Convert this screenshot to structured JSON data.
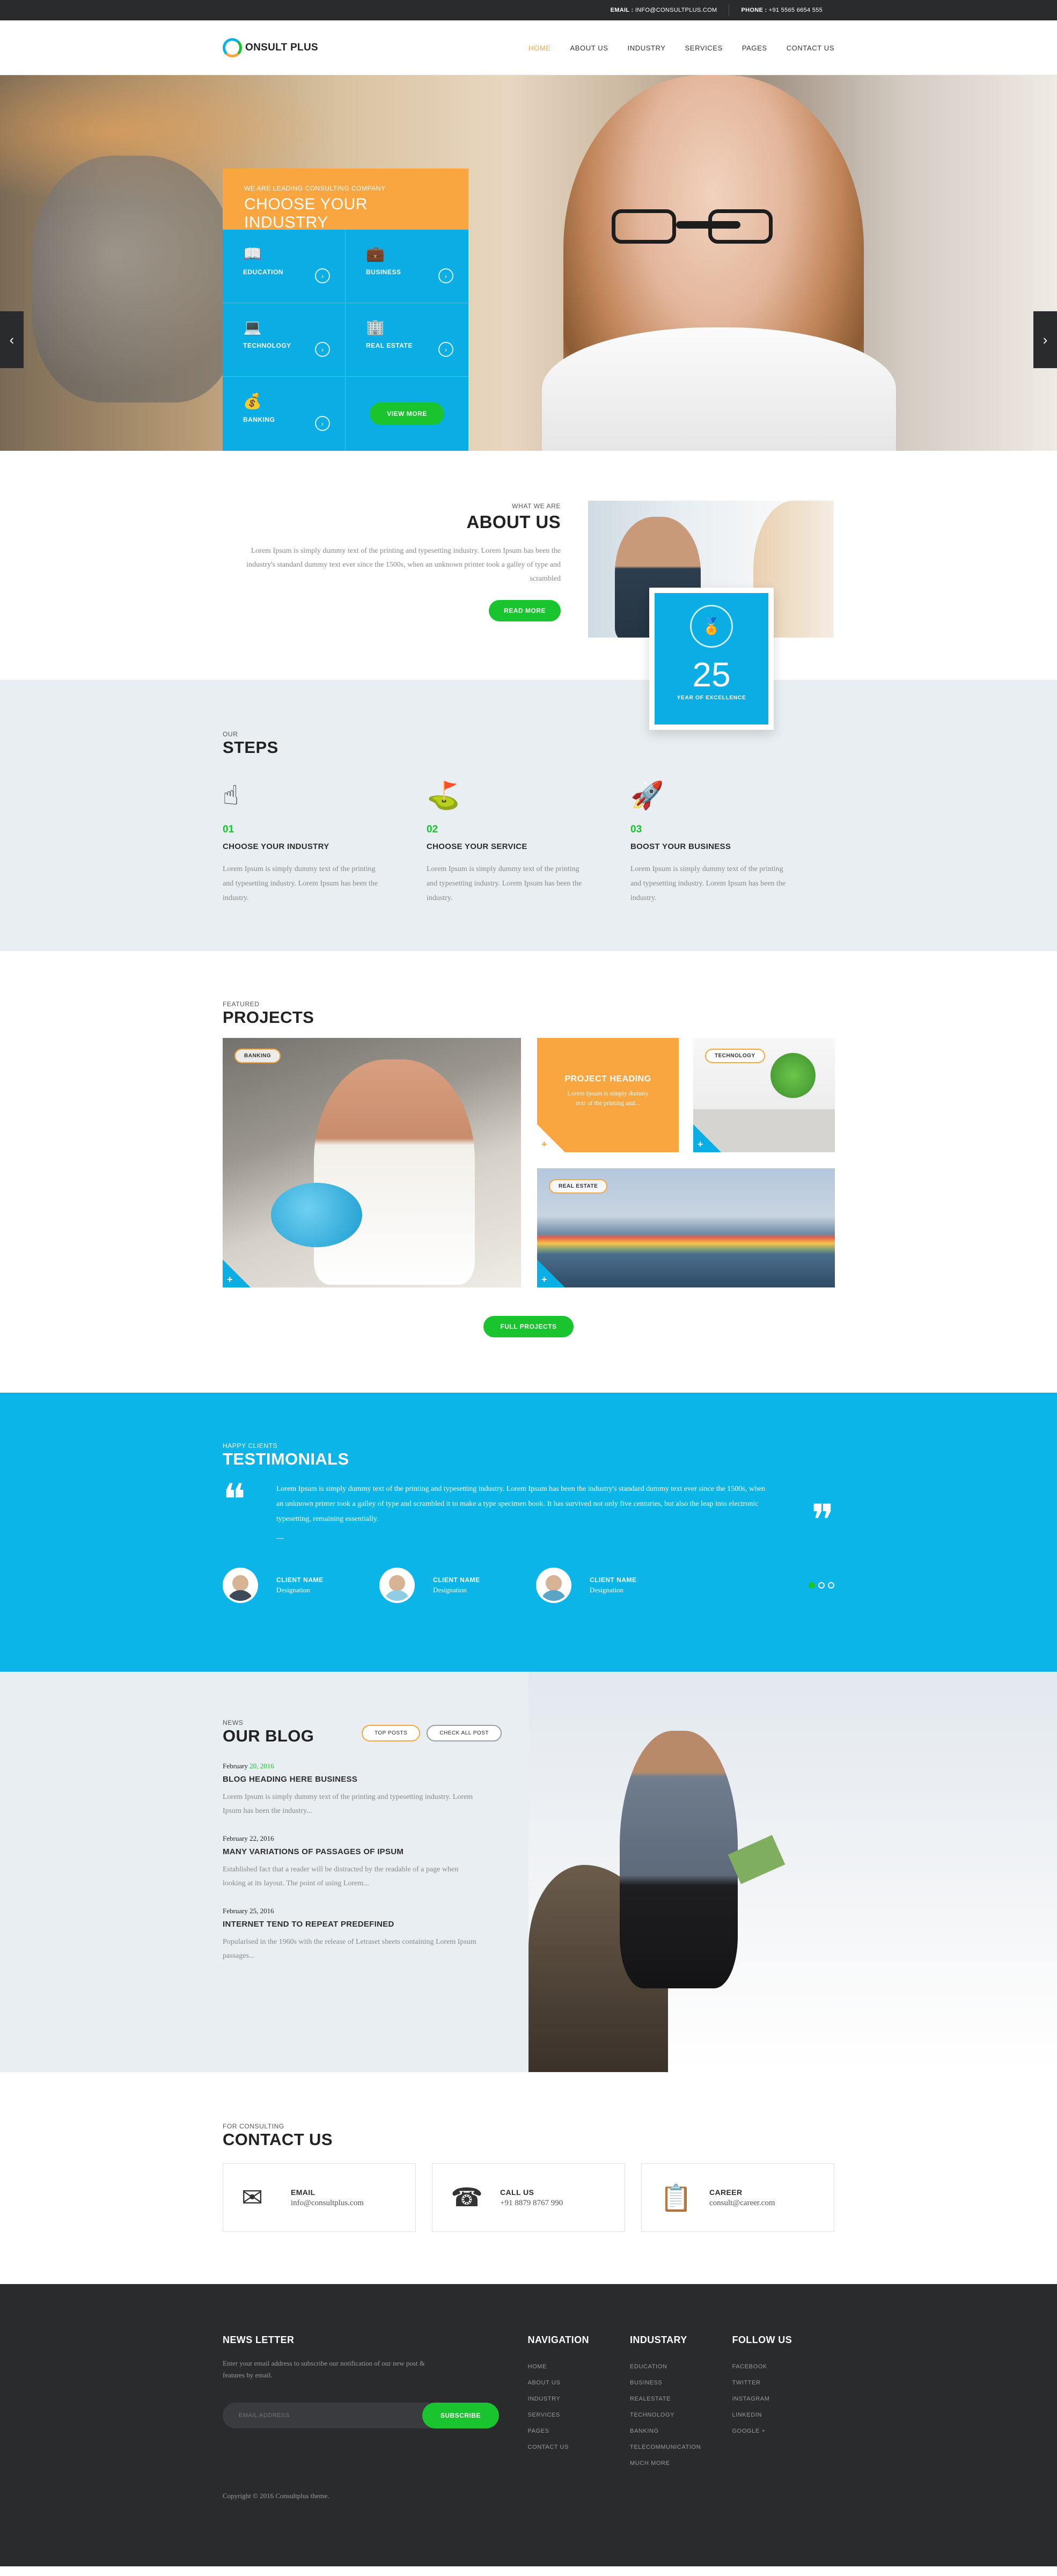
{
  "topbar": {
    "email_label": "EMAIL :",
    "email_value": "INFO@CONSULTPLUS.COM",
    "phone_label": "PHONE :",
    "phone_value": "+91 5565 6654 555"
  },
  "header": {
    "logo_text": "ONSULT PLUS",
    "nav": [
      "HOME",
      "ABOUT US",
      "INDUSTRY",
      "SERVICES",
      "PAGES",
      "CONTACT US"
    ]
  },
  "hero": {
    "eyebrow": "WE ARE LEADING CONSULTING COMPANY",
    "title": "CHOOSE YOUR INDUSTRY",
    "industries": [
      {
        "label": "EDUCATION",
        "icon": "book-icon"
      },
      {
        "label": "BUSINESS",
        "icon": "briefcase-icon"
      },
      {
        "label": "TECHNOLOGY",
        "icon": "laptop-icon"
      },
      {
        "label": "REAL ESTATE",
        "icon": "building-icon"
      },
      {
        "label": "BANKING",
        "icon": "money-bag-icon"
      }
    ],
    "view_more": "VIEW MORE"
  },
  "about": {
    "eyebrow": "WHAT WE ARE",
    "title": "ABOUT US",
    "text": "Lorem Ipsum is simply dummy text of the printing and typesetting industry. Lorem Ipsum has been the industry's standard dummy text ever since the 1500s, when an unknown printer took a galley of type and scrambled",
    "button": "READ MORE",
    "years_number": "25",
    "years_caption": "YEAR OF EXCELLENCE"
  },
  "steps": {
    "eyebrow": "OUR",
    "title": "STEPS",
    "items": [
      {
        "num": "01",
        "title": "CHOOSE YOUR INDUSTRY",
        "text": "Lorem Ipsum is simply dummy text of the printing and typesetting industry. Lorem Ipsum has been the industry."
      },
      {
        "num": "02",
        "title": "CHOOSE YOUR SERVICE",
        "text": "Lorem Ipsum is simply dummy text of the printing and typesetting industry. Lorem Ipsum has been the industry."
      },
      {
        "num": "03",
        "title": "BOOST YOUR BUSINESS",
        "text": "Lorem Ipsum is simply dummy text of the printing and typesetting industry. Lorem Ipsum has been the industry."
      }
    ]
  },
  "projects": {
    "eyebrow": "FEATURED",
    "title": "PROJECTS",
    "tag_banking": "BANKING",
    "tag_technology": "TECHNOLOGY",
    "tag_real_estate": "REAL ESTATE",
    "heading": "PROJECT HEADING",
    "heading_text": "Lorem Ipsum is simply dummy text of the printing and...",
    "button": "FULL PROJECTS"
  },
  "testimonials": {
    "eyebrow": "HAPPY CLIENTS",
    "title": "TESTIMONIALS",
    "quote": "Lorem Ipsum is simply dummy text of the printing and typesetting industry. Lorem Ipsum has been the industry's standard dummy text ever since the 1500s, when an unknown printer took a galley of type and scrambled it to make a type specimen book. It has survived not only five centuries, but also the leap into electronic typesetting, remaining essentially.",
    "dash": "—",
    "clients": [
      {
        "name": "CLIENT NAME",
        "designation": "Designation"
      },
      {
        "name": "CLIENT NAME",
        "designation": "Designation"
      },
      {
        "name": "CLIENT NAME",
        "designation": "Designation"
      }
    ]
  },
  "blog": {
    "eyebrow": "NEWS",
    "title": "OUR BLOG",
    "tab_top": "TOP POSTS",
    "tab_all": "CHECK ALL POST",
    "posts": [
      {
        "date_prefix": "February ",
        "date_day": "20, 2016",
        "title": "BLOG HEADING HERE BUSINESS",
        "text": "Lorem Ipsum is simply dummy text of the printing and typesetting industry. Lorem Ipsum has been the industry..."
      },
      {
        "date_prefix": "February 22, 2016",
        "date_day": "",
        "title": "MANY VARIATIONS OF PASSAGES OF IPSUM",
        "text": "Established fact that a reader will be distracted by the readable of a page when looking at its layout. The point of using Lorem..."
      },
      {
        "date_prefix": "February 25, 2016",
        "date_day": "",
        "title": "INTERNET TEND TO REPEAT PREDEFINED",
        "text": "Popularised in the 1960s with the release of Letraset sheets containing Lorem Ipsum passages..."
      }
    ]
  },
  "contact": {
    "eyebrow": "FOR CONSULTING",
    "title": "CONTACT US",
    "cards": [
      {
        "title": "EMAIL",
        "value": "info@consultplus.com",
        "icon": "envelope-icon"
      },
      {
        "title": "CALL US",
        "value": "+91 8879 8767 990",
        "icon": "phone-icon"
      },
      {
        "title": "CAREER",
        "value": "consult@career.com",
        "icon": "presentation-icon"
      }
    ]
  },
  "footer": {
    "newsletter_title": "NEWS LETTER",
    "newsletter_text": "Enter your email address to subscribe our notification of our new post & features by email.",
    "email_placeholder": "EMAIL ADDRESS",
    "subscribe": "SUBSCRIBE",
    "navigation_title": "NAVIGATION",
    "navigation": [
      "HOME",
      "ABOUT US",
      "INDUSTRY",
      "SERVICES",
      "PAGES",
      "CONTACT US"
    ],
    "industry_title": "INDUSTARY",
    "industry": [
      "EDUCATION",
      "BUSINESS",
      "REALESTATE",
      "TECHNOLOGY",
      "BANKING",
      "TELECOMMUNICATION",
      "MUCH MORE"
    ],
    "follow_title": "FOLLOW US",
    "follow": [
      "FACEBOOK",
      "TWITTER",
      "INSTAGRAM",
      "LINKEDIN",
      "GOOGLE +"
    ],
    "copyright": "Copyright © 2016 Consultplus theme."
  },
  "colors": {
    "accent_orange": "#f9a640",
    "accent_blue": "#0aaee4",
    "accent_green": "#19c42e",
    "dark": "#2a2b2d"
  }
}
